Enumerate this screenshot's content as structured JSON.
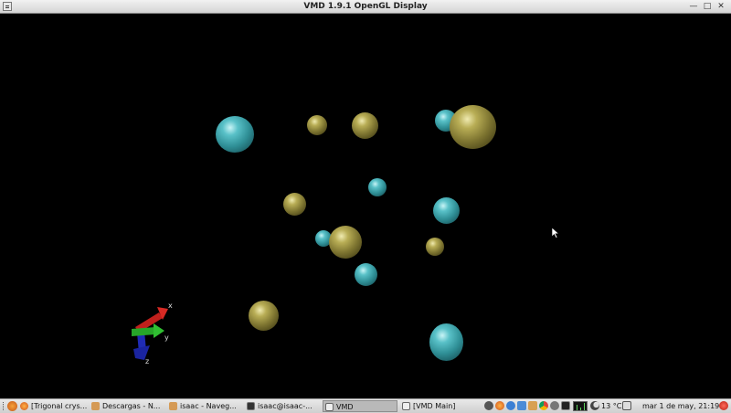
{
  "window": {
    "title": "VMD 1.9.1 OpenGL Display",
    "minimize_glyph": "—",
    "maximize_glyph": "□",
    "close_glyph": "✕"
  },
  "axes": {
    "x_label": "x",
    "y_label": "y",
    "z_label": "z"
  },
  "atom_colors": {
    "gold": "#8c8338",
    "cyan": "#3ea6ad"
  },
  "taskbar": {
    "tasks": [
      {
        "label": "[Trigonal crys...",
        "icon": "firefox-icon"
      },
      {
        "label": "Descargas - N...",
        "icon": "folder-icon"
      },
      {
        "label": "isaac - Naveg...",
        "icon": "folder-icon"
      },
      {
        "label": "isaac@isaac-...",
        "icon": "terminal-icon"
      },
      {
        "label": "VMD",
        "icon": "window-icon",
        "active": true
      },
      {
        "label": "[VMD Main]",
        "icon": "window-icon"
      }
    ],
    "temperature": "13 °C",
    "clock": "mar  1 de may, 21:19"
  }
}
